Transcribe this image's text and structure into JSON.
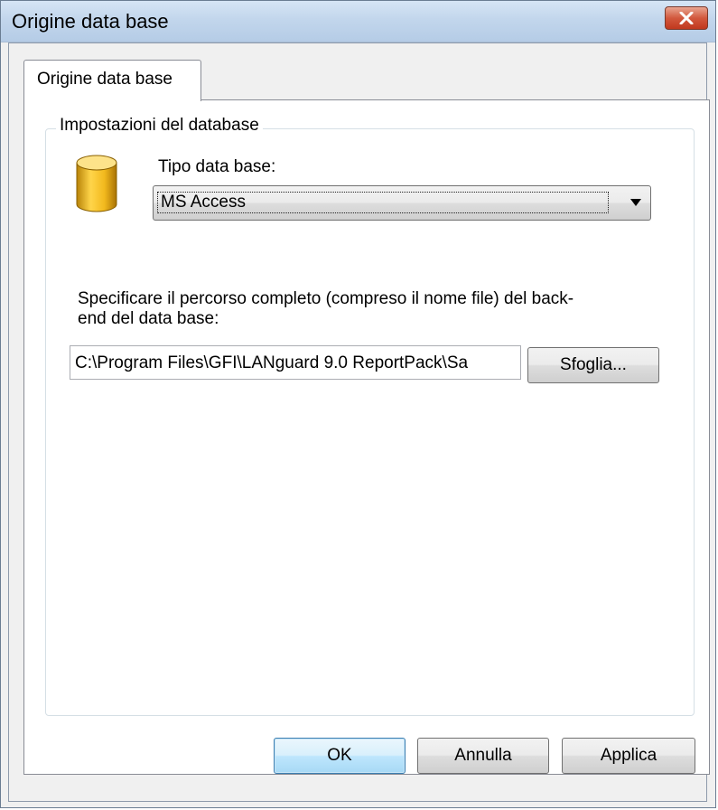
{
  "window": {
    "title": "Origine data base"
  },
  "tabs": [
    {
      "label": "Origine data base"
    }
  ],
  "group": {
    "legend": "Impostazioni del database"
  },
  "database_type": {
    "label": "Tipo data base:",
    "selected": "MS Access"
  },
  "path": {
    "label_line1": "Specificare il percorso completo (compreso il nome file) del back-",
    "label_line2": "end del data base:",
    "value": "C:\\Program Files\\GFI\\LANguard 9.0 ReportPack\\Sa",
    "browse_label": "Sfoglia..."
  },
  "buttons": {
    "ok": "OK",
    "cancel": "Annulla",
    "apply": "Applica"
  },
  "icons": {
    "close": "close-icon",
    "database": "database-icon",
    "dropdown": "chevron-down-icon"
  },
  "colors": {
    "titlebar": "#c2d6ec",
    "close_button": "#d2583d",
    "db_icon": "#e8b21c"
  }
}
